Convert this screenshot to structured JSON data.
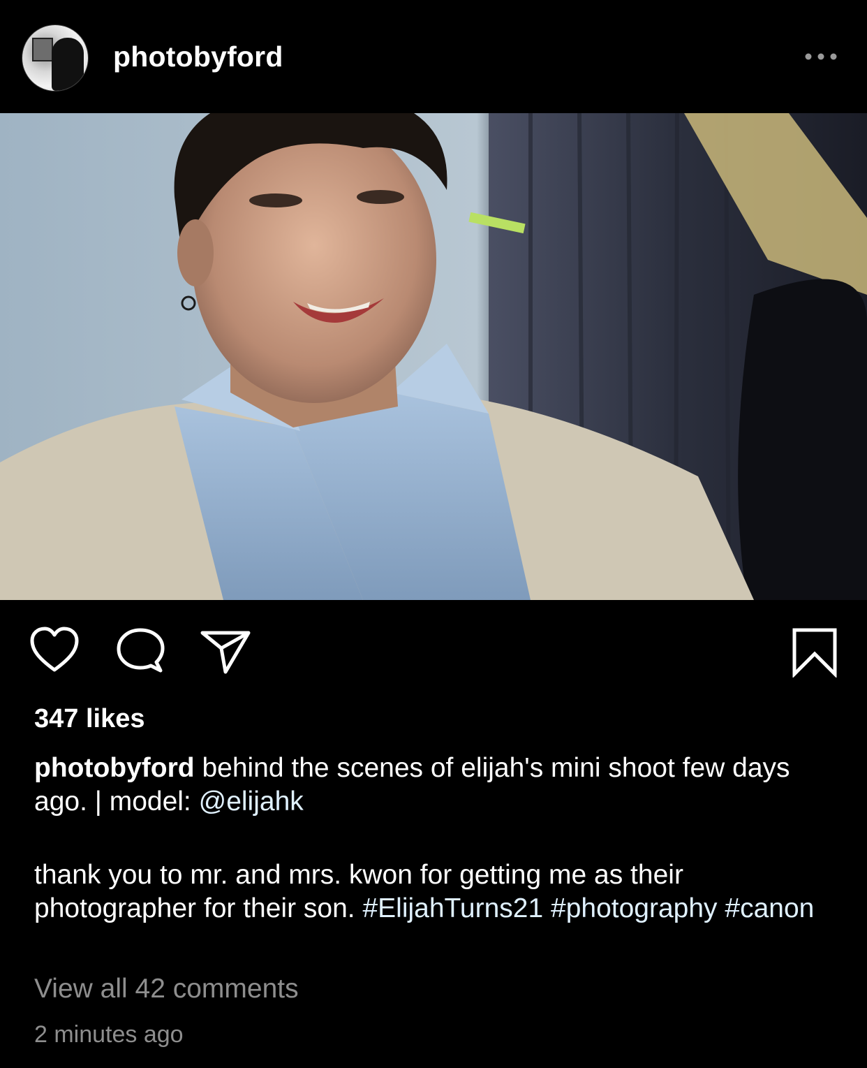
{
  "post": {
    "username": "photobyford",
    "likes": "347 likes",
    "caption": {
      "user": "photobyford",
      "line1": " behind the scenes of elijah's mini shoot few days ago. | model: ",
      "mention": "@elijahk",
      "line2": "thank you to mr. and mrs. kwon for getting me as their photographer for their son. ",
      "hashtags": [
        "#ElijahTurns21",
        "#photography",
        "#canon"
      ]
    },
    "view_comments": "View all 42 comments",
    "timestamp": "2 minutes ago"
  },
  "icons": {
    "avatar": "profile-avatar",
    "more": "more-options-icon",
    "like": "heart-icon",
    "comment": "comment-bubble-icon",
    "share": "paper-plane-icon",
    "save": "bookmark-icon"
  },
  "colors": {
    "background": "#000000",
    "text": "#ffffff",
    "link": "#e0f1ff",
    "muted": "#8e8e8e"
  }
}
